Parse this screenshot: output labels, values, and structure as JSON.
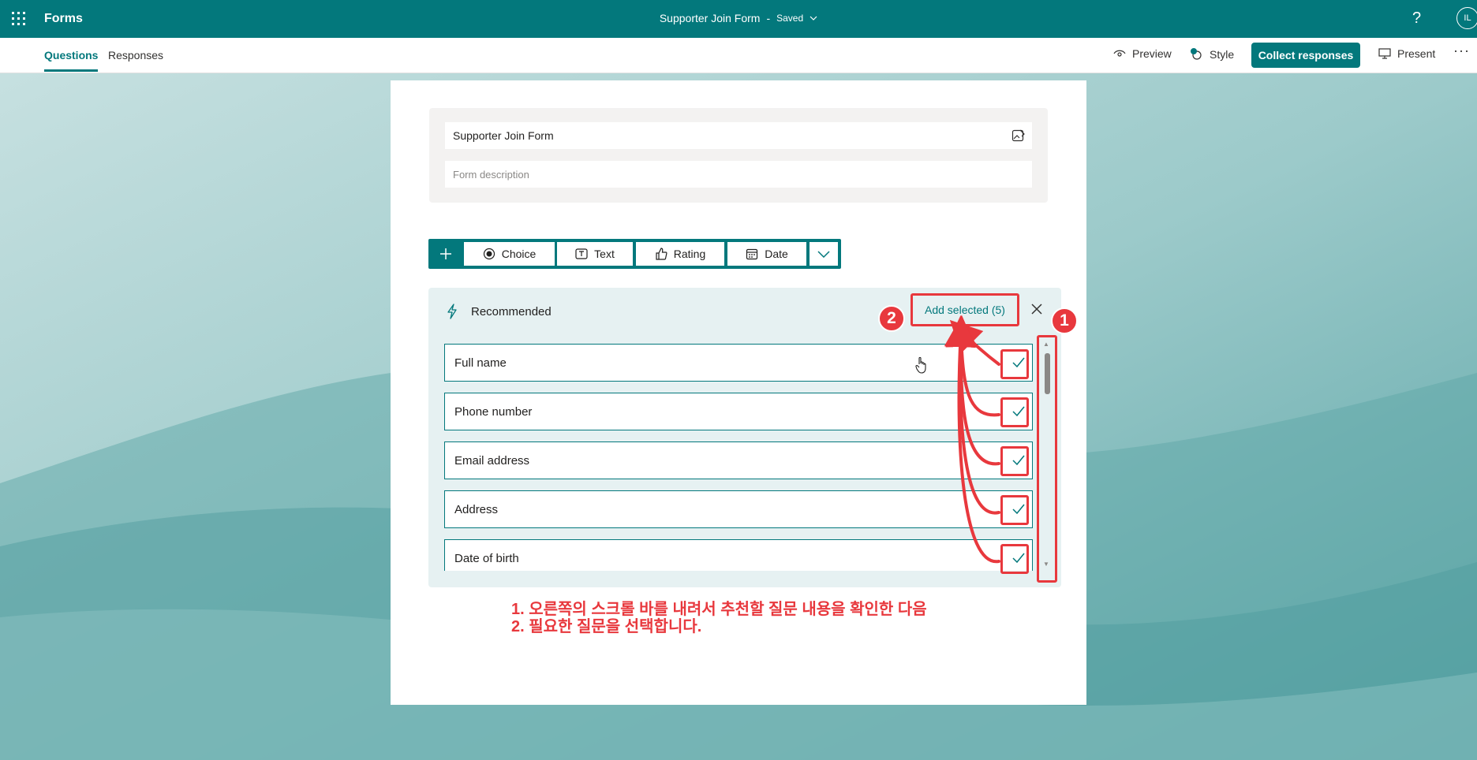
{
  "header": {
    "app_name": "Forms",
    "doc_title": "Supporter Join Form",
    "separator": "-",
    "save_status": "Saved",
    "help": "?",
    "avatar_initials": "IL",
    "accent_color": "#03787c"
  },
  "subbar": {
    "tabs": [
      {
        "label": "Questions",
        "active": true
      },
      {
        "label": "Responses",
        "active": false
      }
    ],
    "preview_label": "Preview",
    "style_label": "Style",
    "collect_label": "Collect responses",
    "present_label": "Present",
    "more_label": "···"
  },
  "form": {
    "title": "Supporter Join Form",
    "description_placeholder": "Form description"
  },
  "question_toolbar": {
    "add_icon": "plus-icon",
    "buttons": [
      {
        "label": "Choice",
        "icon": "radio-icon"
      },
      {
        "label": "Text",
        "icon": "text-icon"
      },
      {
        "label": "Rating",
        "icon": "thumbs-up-icon"
      },
      {
        "label": "Date",
        "icon": "calendar-icon"
      }
    ],
    "more_icon": "chevron-down-icon"
  },
  "recommended": {
    "label": "Recommended",
    "add_selected_label": "Add selected (5)",
    "items": [
      {
        "label": "Full name",
        "checked": true
      },
      {
        "label": "Phone number",
        "checked": true
      },
      {
        "label": "Email address",
        "checked": true
      },
      {
        "label": "Address",
        "checked": true
      },
      {
        "label": "Date of birth",
        "checked": true
      }
    ]
  },
  "annotations": {
    "badge_1": "1",
    "badge_2": "2",
    "line_1": "1. 오른쪽의 스크롤 바를 내려서 추천할 질문 내용을 확인한 다음",
    "line_2": "2. 필요한 질문을 선택합니다.",
    "color": "#e8383d"
  }
}
